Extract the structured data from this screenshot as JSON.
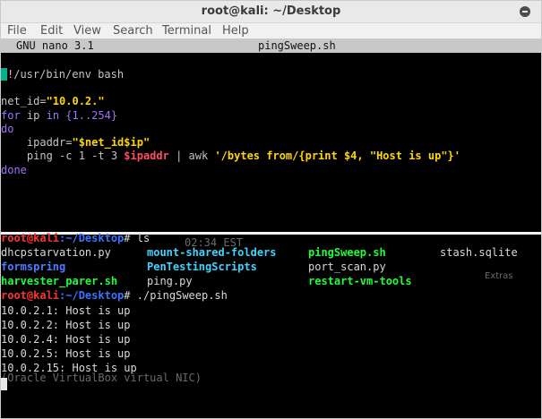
{
  "window": {
    "title": "root@kali: ~/Desktop"
  },
  "menu": [
    "File",
    "Edit",
    "View",
    "Search",
    "Terminal",
    "Help"
  ],
  "nano": {
    "version": "GNU nano 3.1",
    "filename": "pingSweep.sh"
  },
  "script": {
    "shebang": "!/usr/bin/env bash",
    "netid_assign": "net_id=",
    "netid_value": "\"10.0.2.\"",
    "for_kw": "for",
    "for_var": " ip ",
    "in_kw": "in",
    "range": " {1..254}",
    "do_kw": "do",
    "ipaddr_assign": "    ipaddr=",
    "ipaddr_value": "\"$net_id$ip\"",
    "ping_cmd": "    ping -c 1 -t 3 ",
    "ping_var": "$ipaddr",
    "pipe": " | ",
    "awk": "awk",
    "awk_prog": " '/bytes from/{print $4, \"Host is up\"}'",
    "done_kw": "done"
  },
  "shell": {
    "user": "root@kali",
    "path": ":~/Desktop",
    "hash": "#",
    "cmd_ls": " ls",
    "ls_row1": [
      "dhcpstarvation.py",
      "mount-shared-folders",
      "pingSweep.sh",
      "stash.sqlite"
    ],
    "ls_row2": [
      "formspring",
      "PenTestingScripts",
      "port_scan.py"
    ],
    "ls_row3": [
      "harvester_parer.sh",
      "ping.py",
      "restart-vm-tools"
    ],
    "cmd_run": " ./pingSweep.sh",
    "results": [
      "10.0.2.1: Host is up",
      "10.0.2.2: Host is up",
      "10.0.2.4: Host is up",
      "10.0.2.5: Host is up",
      "10.0.2.15: Host is up"
    ]
  },
  "ghost_text": {
    "time": "02:34 EST",
    "extras": "Extras",
    "nic": "(Oracle VirtualBox virtual NIC)"
  }
}
